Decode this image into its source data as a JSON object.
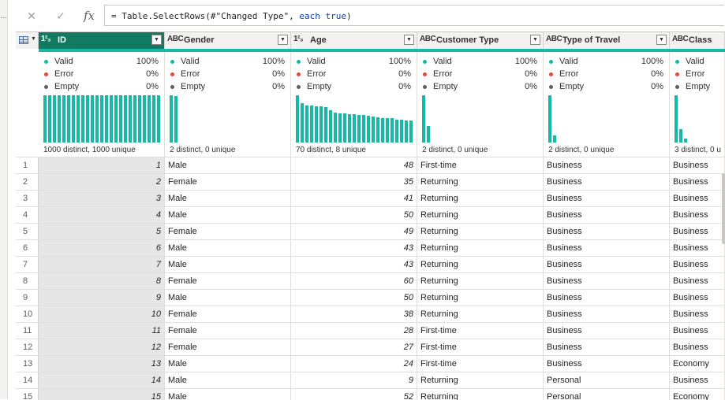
{
  "formula": {
    "cancel_icon": "✕",
    "commit_icon": "✓",
    "fx_label": "fx",
    "prefix": "= Table.SelectRows(#\"Changed Type\", ",
    "kw1": "each",
    "kw2": "true",
    "suffix": ")"
  },
  "left_strip": {
    "dots": "..."
  },
  "colors": {
    "accent": "#127a60",
    "teal": "#17b8a6",
    "error": "#e8473f",
    "empty": "#605e5c"
  },
  "columns": [
    {
      "type_icon": "1²₃",
      "name": "ID",
      "valid_label": "Valid",
      "valid_pct": "100%",
      "error_label": "Error",
      "error_pct": "0%",
      "empty_label": "Empty",
      "empty_pct": "0%",
      "distinct": "1000 distinct, 1000 unique",
      "histogram": [
        1,
        1,
        1,
        1,
        1,
        1,
        1,
        1,
        1,
        1,
        1,
        1,
        1,
        1,
        1,
        1,
        1,
        1,
        1,
        1,
        1,
        1,
        1,
        1,
        1
      ]
    },
    {
      "type_icon": "ABC",
      "name": "Gender",
      "valid_label": "Valid",
      "valid_pct": "100%",
      "error_label": "Error",
      "error_pct": "0%",
      "empty_label": "Empty",
      "empty_pct": "0%",
      "distinct": "2 distinct, 0 unique",
      "histogram": [
        1,
        0.98
      ]
    },
    {
      "type_icon": "1²₃",
      "name": "Age",
      "valid_label": "Valid",
      "valid_pct": "100%",
      "error_label": "Error",
      "error_pct": "0%",
      "empty_label": "Empty",
      "empty_pct": "0%",
      "distinct": "70 distinct, 8 unique",
      "histogram": [
        1,
        0.83,
        0.79,
        0.78,
        0.77,
        0.76,
        0.75,
        0.68,
        0.63,
        0.62,
        0.61,
        0.6,
        0.6,
        0.59,
        0.58,
        0.57,
        0.55,
        0.54,
        0.52,
        0.52,
        0.51,
        0.49,
        0.48,
        0.47,
        0.46
      ]
    },
    {
      "type_icon": "ABC",
      "name": "Customer Type",
      "valid_label": "Valid",
      "valid_pct": "100%",
      "error_label": "Error",
      "error_pct": "0%",
      "empty_label": "Empty",
      "empty_pct": "0%",
      "distinct": "2 distinct, 0 unique",
      "histogram": [
        1,
        0.35
      ]
    },
    {
      "type_icon": "ABC",
      "name": "Type of Travel",
      "valid_label": "Valid",
      "valid_pct": "100%",
      "error_label": "Error",
      "error_pct": "0%",
      "empty_label": "Empty",
      "empty_pct": "0%",
      "distinct": "2 distinct, 0 unique",
      "histogram": [
        1,
        0.15
      ]
    },
    {
      "type_icon": "ABC",
      "name": "Class",
      "valid_label": "Valid",
      "valid_pct": "",
      "error_label": "Error",
      "error_pct": "",
      "empty_label": "Empty",
      "empty_pct": "",
      "distinct": "3 distinct, 0 u",
      "histogram": [
        1,
        0.28,
        0.08
      ]
    }
  ],
  "rows": [
    {
      "n": "1",
      "id": "1",
      "gender": "Male",
      "age": "48",
      "ctype": "First-time",
      "travel": "Business",
      "cls": "Business"
    },
    {
      "n": "2",
      "id": "2",
      "gender": "Female",
      "age": "35",
      "ctype": "Returning",
      "travel": "Business",
      "cls": "Business"
    },
    {
      "n": "3",
      "id": "3",
      "gender": "Male",
      "age": "41",
      "ctype": "Returning",
      "travel": "Business",
      "cls": "Business"
    },
    {
      "n": "4",
      "id": "4",
      "gender": "Male",
      "age": "50",
      "ctype": "Returning",
      "travel": "Business",
      "cls": "Business"
    },
    {
      "n": "5",
      "id": "5",
      "gender": "Female",
      "age": "49",
      "ctype": "Returning",
      "travel": "Business",
      "cls": "Business"
    },
    {
      "n": "6",
      "id": "6",
      "gender": "Male",
      "age": "43",
      "ctype": "Returning",
      "travel": "Business",
      "cls": "Business"
    },
    {
      "n": "7",
      "id": "7",
      "gender": "Male",
      "age": "43",
      "ctype": "Returning",
      "travel": "Business",
      "cls": "Business"
    },
    {
      "n": "8",
      "id": "8",
      "gender": "Female",
      "age": "60",
      "ctype": "Returning",
      "travel": "Business",
      "cls": "Business"
    },
    {
      "n": "9",
      "id": "9",
      "gender": "Male",
      "age": "50",
      "ctype": "Returning",
      "travel": "Business",
      "cls": "Business"
    },
    {
      "n": "10",
      "id": "10",
      "gender": "Female",
      "age": "38",
      "ctype": "Returning",
      "travel": "Business",
      "cls": "Business"
    },
    {
      "n": "11",
      "id": "11",
      "gender": "Female",
      "age": "28",
      "ctype": "First-time",
      "travel": "Business",
      "cls": "Business"
    },
    {
      "n": "12",
      "id": "12",
      "gender": "Female",
      "age": "27",
      "ctype": "First-time",
      "travel": "Business",
      "cls": "Business"
    },
    {
      "n": "13",
      "id": "13",
      "gender": "Male",
      "age": "24",
      "ctype": "First-time",
      "travel": "Business",
      "cls": "Economy"
    },
    {
      "n": "14",
      "id": "14",
      "gender": "Male",
      "age": "9",
      "ctype": "Returning",
      "travel": "Personal",
      "cls": "Business"
    },
    {
      "n": "15",
      "id": "15",
      "gender": "Male",
      "age": "52",
      "ctype": "Returning",
      "travel": "Personal",
      "cls": "Economy"
    }
  ]
}
